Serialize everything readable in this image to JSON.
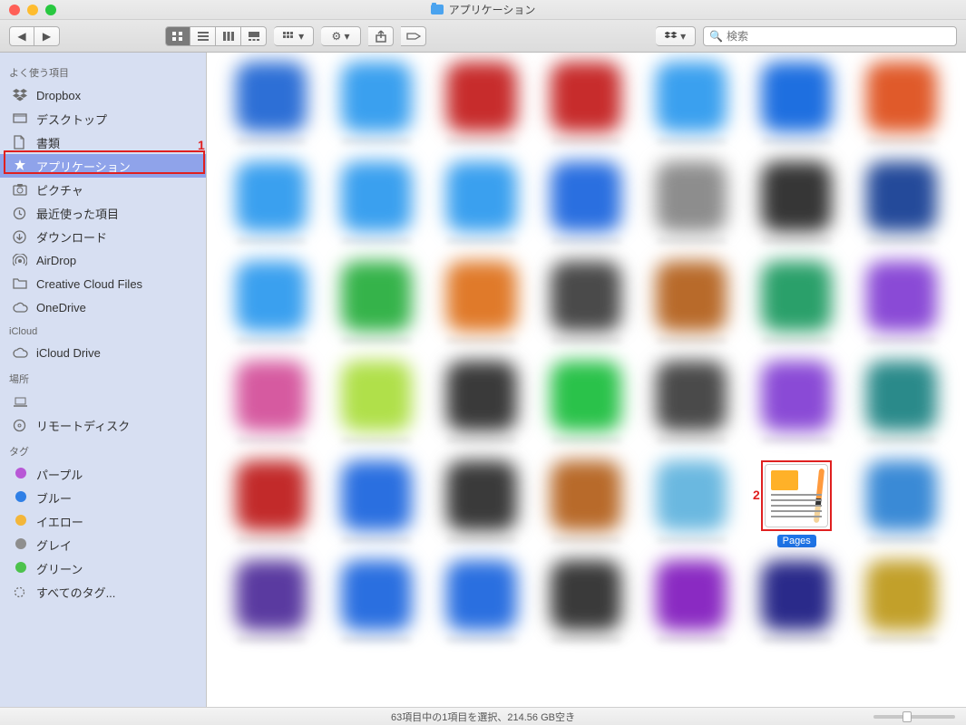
{
  "window": {
    "title": "アプリケーション"
  },
  "toolbar": {
    "search_placeholder": "検索"
  },
  "sidebar": {
    "sections": {
      "favorites": {
        "header": "よく使う項目",
        "items": [
          {
            "icon": "dropbox",
            "label": "Dropbox"
          },
          {
            "icon": "desktop",
            "label": "デスクトップ"
          },
          {
            "icon": "documents",
            "label": "書類"
          },
          {
            "icon": "applications",
            "label": "アプリケーション",
            "active": true
          },
          {
            "icon": "pictures",
            "label": "ピクチャ"
          },
          {
            "icon": "recents",
            "label": "最近使った項目"
          },
          {
            "icon": "downloads",
            "label": "ダウンロード"
          },
          {
            "icon": "airdrop",
            "label": "AirDrop"
          },
          {
            "icon": "folder",
            "label": "Creative Cloud Files"
          },
          {
            "icon": "cloud",
            "label": "OneDrive"
          }
        ]
      },
      "icloud": {
        "header": "iCloud",
        "items": [
          {
            "icon": "cloud",
            "label": "iCloud Drive"
          }
        ]
      },
      "locations": {
        "header": "場所",
        "items": [
          {
            "icon": "laptop",
            "label": ""
          },
          {
            "icon": "disc",
            "label": "リモートディスク"
          }
        ]
      },
      "tags": {
        "header": "タグ",
        "items": [
          {
            "color": "#b858d6",
            "label": "パープル"
          },
          {
            "color": "#2f7fe6",
            "label": "ブルー"
          },
          {
            "color": "#f3b63a",
            "label": "イエロー"
          },
          {
            "color": "#8e8e8e",
            "label": "グレイ"
          },
          {
            "color": "#4cc24c",
            "label": "グリーン"
          },
          {
            "color": "alltags",
            "label": "すべてのタグ..."
          }
        ]
      }
    }
  },
  "grid": {
    "rows": 6,
    "cols": 7,
    "selected_item": {
      "row": 4,
      "col": 5,
      "name": "Pages"
    },
    "palette": [
      [
        "#2d6fd6",
        "#3aa0ef",
        "#c72c2c",
        "#c72c2c",
        "#3aa0ef",
        "#1e6fe0",
        "#e05a2a"
      ],
      [
        "#3aa0ef",
        "#3aa0ef",
        "#3aa0ef",
        "#2a6fe0",
        "#8d8d8d",
        "#363636",
        "#244a9a"
      ],
      [
        "#3aa0ef",
        "#35b34a",
        "#e07a2a",
        "#4a4a4a",
        "#b86a2a",
        "#2aa06a",
        "#8a4ad6"
      ],
      [
        "#d65aa0",
        "#b0e04a",
        "#3a3a3a",
        "#2ac24a",
        "#4a4a4a",
        "#8a4ad6",
        "#2a8a8a"
      ],
      [
        "#c22a2a",
        "#2a6fe0",
        "#3a3a3a",
        "#b86a2a",
        "#6ab8e0",
        "#ffffff",
        "#3a8ad6"
      ],
      [
        "#5a3aa0",
        "#2a6fe0",
        "#2a6fe0",
        "#3a3a3a",
        "#8a2ac2",
        "#2a2a8a",
        "#c2a02a"
      ]
    ]
  },
  "callouts": {
    "one": "1",
    "two": "2"
  },
  "status": {
    "text": "63項目中の1項目を選択、214.56 GB空き"
  }
}
